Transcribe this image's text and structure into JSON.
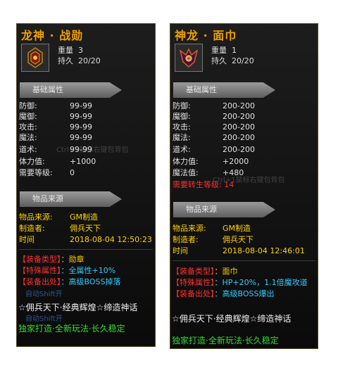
{
  "left": {
    "title": "龙神 · 战勋",
    "weight_label": "重量",
    "weight_value": "3",
    "durability_label": "持久",
    "durability_value": "20/20",
    "section_basic": "基础属性",
    "attrs": [
      {
        "k": "防御:",
        "v": "99-99"
      },
      {
        "k": "魔御:",
        "v": "99-99"
      },
      {
        "k": "攻击:",
        "v": "99-99"
      },
      {
        "k": "魔法:",
        "v": "99-99"
      },
      {
        "k": "道术:",
        "v": "99-99"
      },
      {
        "k": "体力值:",
        "v": "+1000"
      },
      {
        "k": "需要等级:",
        "v": "0"
      }
    ],
    "section_source": "物品来源",
    "source": [
      {
        "k": "物品来源:",
        "v": "GM制造"
      },
      {
        "k": "制造者:",
        "v": "佣兵天下"
      },
      {
        "k": "时间",
        "v": "2018-08-04  12:50:23"
      }
    ],
    "features": [
      {
        "k": "【装备类型】",
        "v": "：勋章"
      },
      {
        "k": "【特殊属性】",
        "v": "：全属性+10%"
      },
      {
        "k": "【装备出处】",
        "v": "：高级BOSS掉落"
      }
    ],
    "slogan1": "☆佣兵天下·经典辉煌☆缔造神话",
    "slogan2": "独家打造·全新玩法·长久稳定",
    "ghost1": "Ctrl+1鼠标右键包背包",
    "ghost2": "自动Shift开",
    "ghost3": "自动Shift开"
  },
  "right": {
    "title": "神龙 · 面巾",
    "weight_label": "重量",
    "weight_value": "1",
    "durability_label": "持久",
    "durability_value": "20/20",
    "section_basic": "基础属性",
    "attrs": [
      {
        "k": "防御:",
        "v": "200-200"
      },
      {
        "k": "魔御:",
        "v": "200-200"
      },
      {
        "k": "攻击:",
        "v": "200-200"
      },
      {
        "k": "魔法:",
        "v": "200-200"
      },
      {
        "k": "道术:",
        "v": "200-200"
      },
      {
        "k": "体力值:",
        "v": "+2000"
      },
      {
        "k": "魔法值:",
        "v": "+480"
      }
    ],
    "req_line": "需要转生等级: 14",
    "section_source": "物品来源",
    "source": [
      {
        "k": "物品来源:",
        "v": "GM制造"
      },
      {
        "k": "制造者:",
        "v": "佣兵天下"
      },
      {
        "k": "时间",
        "v": "2018-08-04  12:46:01"
      }
    ],
    "features": [
      {
        "k": "【装备类型】",
        "v": "：面巾"
      },
      {
        "k": "【特殊属性】",
        "v": "：HP+20%，1.1倍魔攻道"
      },
      {
        "k": "【装备出处】",
        "v": "：高级BOSS爆出"
      }
    ],
    "slogan1": "☆佣兵天下·经典辉煌☆缔造神话",
    "slogan2": "独家打造·全新玩法·长久稳定",
    "ghost1": "Ctrl+1鼠标右键包背包"
  },
  "colors": {
    "title": "#f0a000",
    "red": "#ff3030",
    "yellow": "#ffd200",
    "cyan": "#33ccff",
    "green": "#33dd33"
  }
}
